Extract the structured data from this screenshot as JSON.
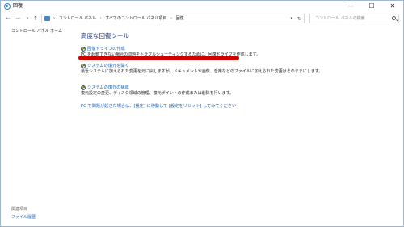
{
  "window": {
    "title": "回復",
    "controls": {
      "minimize": "—",
      "maximize": "☐",
      "close": "✕"
    }
  },
  "address_bar": {
    "back": "←",
    "forward": "→",
    "recent": "▾",
    "up": "↑",
    "crumbs": [
      "コントロール パネル",
      "すべてのコントロール パネル項目",
      "回復"
    ],
    "crumb_separator": "›",
    "dropdown": "▾",
    "refresh": "↻",
    "search_placeholder": "コントロール パネルの検索"
  },
  "left_pane": {
    "home_link": "コントロール パネル ホーム",
    "related_heading": "関連項目",
    "related_links": [
      "ファイル履歴"
    ]
  },
  "main": {
    "title": "高度な回復ツール",
    "tasks": [
      {
        "title": "回復ドライブの作成",
        "description": "PC を起動できない場合の問題をトラブルシューティングするために、回復ドライブを作成します。"
      },
      {
        "title": "システムの復元を開く",
        "description": "最近システムに加えられた変更を元に戻しますが、ドキュメントや画像、音楽などのファイルに加えられた変更はそのままにします。"
      },
      {
        "title": "システムの復元の構成",
        "description": "復元設定の変更、ディスク領域の管理、復元ポイントの作成または削除を行います。"
      }
    ],
    "help_link": "PC で問題が起きた場合は、[設定] に移動して [設定をリセット] してみてください"
  },
  "colors": {
    "title_blue": "#1e3287",
    "link_blue": "#1a5fb4",
    "highlight_red": "#d40000"
  }
}
